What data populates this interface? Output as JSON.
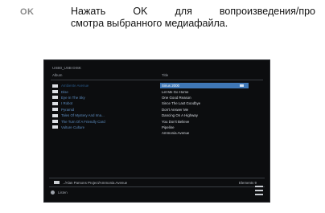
{
  "ok_key": "OK",
  "instruction": {
    "line1": "Нажать OK для вопроизведения/про",
    "line2": "смотра выбранного медиафайла."
  },
  "screen": {
    "device": "USB0_USB DISK",
    "breadcrumb": "Album",
    "folder_col": "",
    "title_col": "Title",
    "folders": [
      "Ambiente Avenue",
      "Dise",
      "Eye In The Sky",
      "I Robot",
      "Pyramid",
      "Tales Of Mystery And Ima...",
      "The Turn Of A Friendly Card",
      "Vulture Culture"
    ],
    "tracks": [
      "Sirius 2000",
      "Let Me Go Home",
      "One Good Reason",
      "Since The Last Goodbye",
      "Don't Answer Me",
      "Dancing On A Highway",
      "You Don't Believe",
      "Pipeline",
      "Ammonia Avenue"
    ],
    "selected_track_index": 0,
    "path": "../Alan Parsons Project/Ammonia Avenue",
    "elements": "Elements 9",
    "footer_hint": "Listen"
  },
  "colors": {
    "selection": "#3f77b6",
    "folder_text": "#5d8ec2",
    "screen_bg": "#0c0d0f"
  }
}
